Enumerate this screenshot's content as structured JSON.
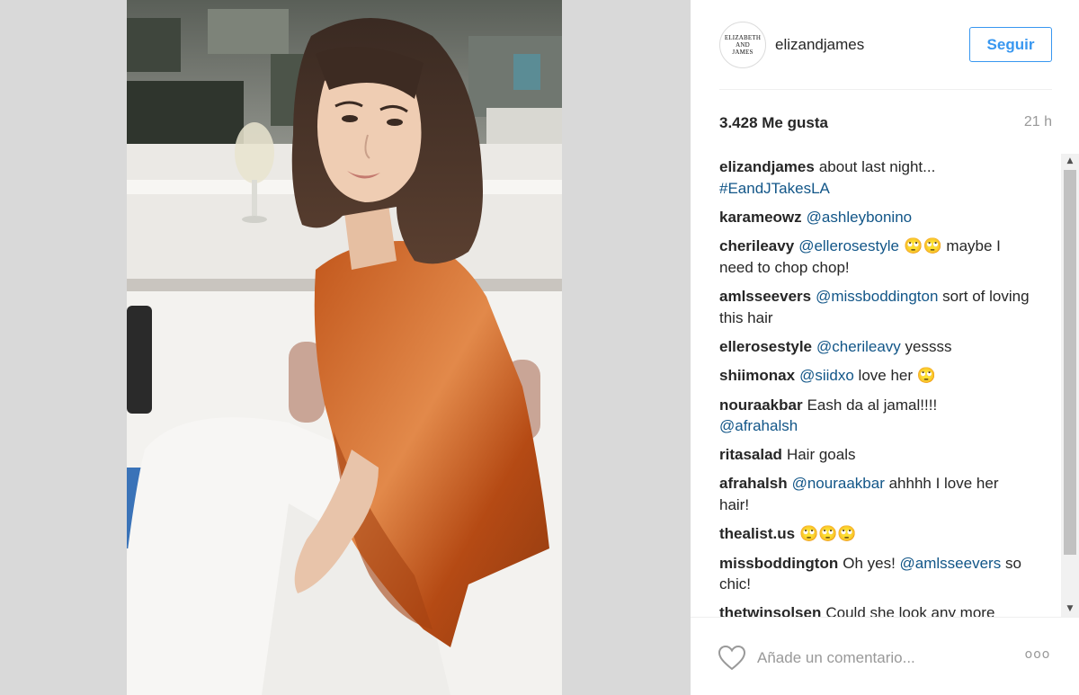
{
  "post": {
    "image_alt": "Woman in orange satin top sitting on a rooftop",
    "account": {
      "username": "elizandjames",
      "avatar_lines": [
        "ELIZABETH",
        "AND",
        "JAMES"
      ]
    },
    "follow_label": "Seguir",
    "likes": "3.428 Me gusta",
    "time": "21 h",
    "comments": [
      {
        "author": "elizandjames",
        "parts": [
          {
            "t": "about last night..."
          },
          {
            "br": true
          },
          {
            "m": "#EandJTakesLA"
          }
        ]
      },
      {
        "author": "karameowz",
        "parts": [
          {
            "m": "@ashleybonino"
          }
        ]
      },
      {
        "author": "cherileavy",
        "parts": [
          {
            "m": "@ellerosestyle"
          },
          {
            "e": " 🙄🙄"
          },
          {
            "t": " maybe I need to chop chop!"
          }
        ]
      },
      {
        "author": "amlsseevers",
        "parts": [
          {
            "m": "@missboddington"
          },
          {
            "t": " sort of loving this hair"
          }
        ]
      },
      {
        "author": "ellerosestyle",
        "parts": [
          {
            "m": "@cherileavy"
          },
          {
            "t": " yessss"
          }
        ]
      },
      {
        "author": "shiimonax",
        "parts": [
          {
            "m": "@siidxo"
          },
          {
            "t": " love her "
          },
          {
            "e": "🙄"
          }
        ]
      },
      {
        "author": "nouraakbar",
        "parts": [
          {
            "t": "Eash da al jamal!!!!"
          },
          {
            "br": true
          },
          {
            "m": "@afrahalsh"
          }
        ]
      },
      {
        "author": "ritasalad",
        "parts": [
          {
            "t": "Hair goals"
          }
        ]
      },
      {
        "author": "afrahalsh",
        "parts": [
          {
            "m": "@nouraakbar"
          },
          {
            "t": " ahhhh I love her hair!"
          }
        ]
      },
      {
        "author": "thealist.us",
        "parts": [
          {
            "e": "🙄🙄🙄"
          }
        ]
      },
      {
        "author": "missboddington",
        "parts": [
          {
            "t": "Oh yes! "
          },
          {
            "m": "@amlsseevers"
          },
          {
            "t": " so chic!"
          }
        ]
      },
      {
        "author": "thetwinsolsen",
        "parts": [
          {
            "t": "Could she look any more"
          }
        ]
      }
    ],
    "comment_placeholder": "Añade un comentario...",
    "more_label": "ooo"
  },
  "scrollbar": {
    "up": "▲",
    "down": "▼"
  },
  "colors": {
    "accent": "#3897f0",
    "mention": "#125688",
    "muted": "#999999"
  }
}
